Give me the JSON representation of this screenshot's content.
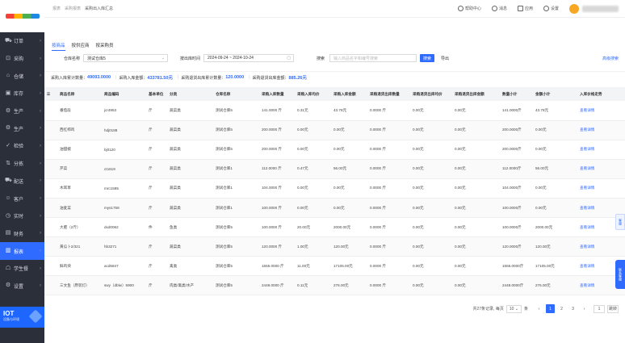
{
  "sidebar": {
    "items": [
      {
        "label": "订单",
        "icon": "cart-icon"
      },
      {
        "label": "采购",
        "icon": "bag-icon"
      },
      {
        "label": "仓储",
        "icon": "home-icon"
      },
      {
        "label": "库存",
        "icon": "box-icon"
      },
      {
        "label": "生产",
        "icon": "factory-icon"
      },
      {
        "label": "生产",
        "icon": "factory-icon"
      },
      {
        "label": "检验",
        "icon": "check-icon"
      },
      {
        "label": "分拣",
        "icon": "sort-icon"
      },
      {
        "label": "配送",
        "icon": "truck-icon"
      },
      {
        "label": "客户",
        "icon": "user-icon"
      },
      {
        "label": "实时",
        "icon": "clock-icon"
      },
      {
        "label": "财务",
        "icon": "wallet-icon"
      },
      {
        "label": "报表",
        "icon": "chart-icon"
      },
      {
        "label": "学生餐",
        "icon": "student-icon"
      },
      {
        "label": "设置",
        "icon": "gear-icon"
      }
    ],
    "active_index": 12,
    "iot": {
      "title": "IOT",
      "subtitle": "设备与环境"
    }
  },
  "header": {
    "breadcrumbs": [
      "报表",
      "采购报表",
      "采购出入库汇总"
    ],
    "help": "帮助中心",
    "notice": "消息",
    "app": "应用",
    "setting": "设置"
  },
  "tabs": [
    "按商品",
    "按供应商",
    "按采购员"
  ],
  "filters": {
    "warehouse_label": "仓库名称",
    "warehouse_value": "测试仓库5",
    "date_label": "按出库时间",
    "date_value": "2024-09-24 ~ 2024-10-24",
    "search_label": "搜索",
    "search_placeholder": "输入商品名字和编号搜索",
    "search_button": "搜索",
    "export_button": "导出",
    "more_link": "高级搜索"
  },
  "summary": [
    {
      "label": "采购入库累计数量：",
      "value": "49093.0000"
    },
    {
      "label": "采购入库金额：",
      "value": "433781.50元"
    },
    {
      "label": "采购退货出库累计数量：",
      "value": "120.0000"
    },
    {
      "label": "采购退货出库金额：",
      "value": "885.26元"
    }
  ],
  "table": {
    "columns": [
      "商品名称",
      "商品编码",
      "基本单位",
      "分类",
      "仓库名称",
      "采购入库数量",
      "采购入库均价",
      "采购入库金额",
      "采购退货出库数量",
      "采购退货出库均价",
      "采购退货出库金额",
      "数量小计",
      "金额小计",
      "入库价格走势"
    ],
    "rows": [
      [
        "番茄段",
        "jcr4953",
        "斤",
        "蔬菜类",
        "测试仓库5",
        "141.0000 斤",
        "0.31元",
        "43.78元",
        "0.0000 斤",
        "0.00元",
        "0.00元",
        "141.0000斤",
        "43.78元",
        "查看详情"
      ],
      [
        "西红柿鸡",
        "hdj0188",
        "斤",
        "蔬菜类",
        "测试仓库5",
        "200.0000 斤",
        "0.00元",
        "0.00元",
        "0.0000 斤",
        "0.00元",
        "0.00元",
        "200.0000斤",
        "0.00元",
        "查看详情"
      ],
      [
        "油甜椒",
        "bj0120",
        "斤",
        "蔬菜类",
        "测试仓库5",
        "200.0000 斤",
        "0.00元",
        "0.00元",
        "0.0000 斤",
        "0.00元",
        "0.00元",
        "200.0000斤",
        "0.00元",
        "查看详情"
      ],
      [
        "芹菜",
        "ct1619",
        "斤",
        "蔬菜类",
        "测试仓库1",
        "112.0000 斤",
        "0.47元",
        "56.00元",
        "0.0000 斤",
        "0.00元",
        "0.00元",
        "112.0000斤",
        "56.00元",
        "查看详情"
      ],
      [
        "木耳草",
        "mrc1595",
        "斤",
        "蔬菜类",
        "测试仓库1",
        "104.0000 斤",
        "0.00元",
        "0.00元",
        "0.0000 斤",
        "0.00元",
        "0.00元",
        "104.0000斤",
        "0.00元",
        "查看详情"
      ],
      [
        "油麦菜",
        "mys1759",
        "斤",
        "蔬菜类",
        "测试仓库1",
        "100.0000 斤",
        "0.00元",
        "0.00元",
        "0.0000 斤",
        "0.00元",
        "0.00元",
        "100.0000斤",
        "0.00元",
        "查看详情"
      ],
      [
        "大肥（2斤）",
        "dxd0062",
        "件",
        "鱼类",
        "测试仓库5",
        "100.0000 斤",
        "20.00元",
        "2000.00元",
        "0.0000 斤",
        "0.00元",
        "0.00元",
        "100.0000斤",
        "2000.00元",
        "查看详情"
      ],
      [
        "黄瓜卜2/321",
        "hb3271",
        "斤",
        "蔬菜类",
        "测试仓库5",
        "120.0000 斤",
        "1.00元",
        "120.00元",
        "0.0000 斤",
        "0.00元",
        "0.00元",
        "120.0000斤",
        "120.00元",
        "查看详情"
      ],
      [
        "鲜鸡块",
        "acd5847",
        "斤",
        "禽类",
        "测试仓库5",
        "1555.0000 斤",
        "11.00元",
        "17105.00元",
        "0.0000 斤",
        "0.00元",
        "0.00元",
        "1555.0000斤",
        "17105.00元",
        "查看详情"
      ],
      [
        "三文鱼（原装灯）",
        "swy（dblw）5900",
        "斤",
        "肉类/禽类/水产",
        "测试仓库5",
        "2448.0000 斤",
        "0.11元",
        "276.00元",
        "0.0000 斤",
        "0.00元",
        "0.00元",
        "2448.0000斤",
        "276.00元",
        "查看详情"
      ]
    ]
  },
  "pager": {
    "total": "共27条记录, 每页",
    "page_size": "10",
    "unit": "条",
    "pages": [
      "1",
      "2",
      "3"
    ],
    "jump_label": "1",
    "go": "跳转"
  },
  "float": {
    "feedback": "客服",
    "contact": "联系客服"
  }
}
